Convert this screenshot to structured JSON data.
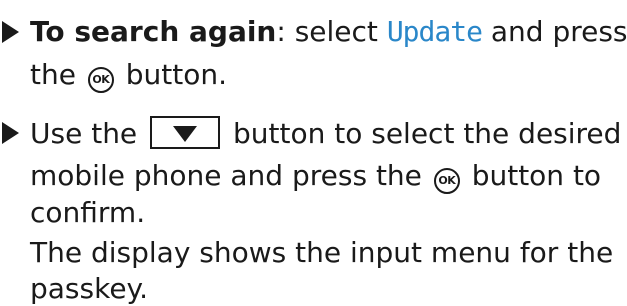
{
  "item1": {
    "lead_bold": "To search again",
    "text_a": ": select ",
    "display_option": "Update",
    "text_b": " and press",
    "line2_a": "the ",
    "ok_icon_label": "OK",
    "line2_b": " button."
  },
  "item2": {
    "line1_a": "Use the ",
    "down_button_icon": "down-arrow-icon",
    "line1_b": " button to select the desired",
    "line2_a": "mobile phone and press the ",
    "ok_icon_label": "OK",
    "line2_b": " button to",
    "line3": "confirm.",
    "result_line1": "The display shows the input menu for the",
    "result_line2": "passkey."
  },
  "colors": {
    "display_text": "#2a87c9",
    "body_text": "#1a1a1a"
  }
}
